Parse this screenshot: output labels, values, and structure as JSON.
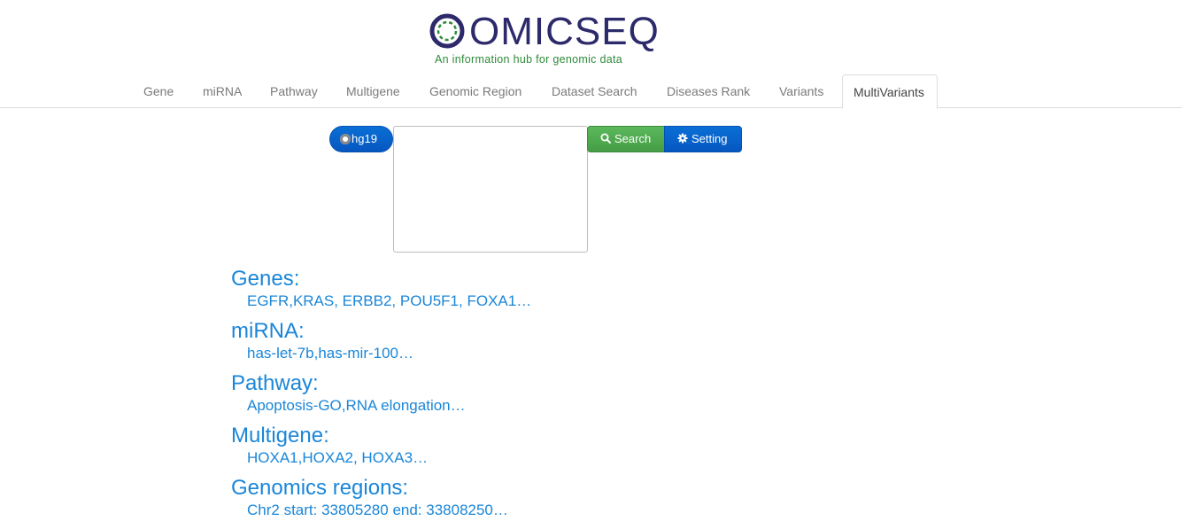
{
  "logo": {
    "name": "OMICSEQ",
    "tagline": "An information hub for genomic data"
  },
  "nav": {
    "tabs": [
      {
        "label": "Gene"
      },
      {
        "label": "miRNA"
      },
      {
        "label": "Pathway"
      },
      {
        "label": "Multigene"
      },
      {
        "label": "Genomic Region"
      },
      {
        "label": "Dataset Search"
      },
      {
        "label": "Diseases Rank"
      },
      {
        "label": "Variants"
      },
      {
        "label": "MultiVariants"
      }
    ],
    "active": "MultiVariants"
  },
  "search": {
    "genome_label": "hg19",
    "query_value": "",
    "search_label": "Search",
    "setting_label": "Setting"
  },
  "examples": {
    "genes": {
      "title": "Genes:",
      "value": "EGFR,KRAS, ERBB2, POU5F1, FOXA1…"
    },
    "mirna": {
      "title": "miRNA:",
      "value": "has-let-7b,has-mir-100…"
    },
    "pathway": {
      "title": "Pathway:",
      "value": "Apoptosis-GO,RNA elongation…"
    },
    "multigene": {
      "title": "Multigene:",
      "value": "HOXA1,HOXA2, HOXA3…"
    },
    "regions": {
      "title": "Genomics regions:",
      "value": "Chr2 start: 33805280 end: 33808250…"
    }
  },
  "colors": {
    "brand_navy": "#2d2a6b",
    "brand_green": "#2f8a3a",
    "link_blue": "#1a86d8",
    "button_blue": "#0657c0",
    "button_green": "#449d44"
  },
  "icons": {
    "search": "magnifier-icon",
    "setting": "gear-icon",
    "logo": "omicseq-ring-icon"
  }
}
